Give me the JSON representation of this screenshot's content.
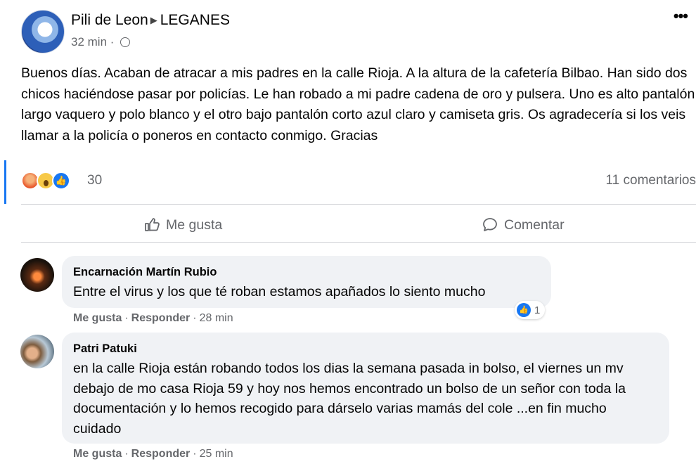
{
  "post": {
    "author": "Pili de Leon",
    "group": "LEGANES",
    "time": "32 min",
    "text": "Buenos días. Acaban de atracar a mis padres en la calle Rioja. A la altura de la cafetería Bilbao. Han sido dos chicos haciéndose pasar por policías. Le han robado a mi padre cadena de oro y pulsera. Uno es alto pantalón largo vaquero y polo blanco y el otro bajo pantalón corto azul claro y camiseta gris. Os agradecería si los veis llamar a la policía o poneros en contacto conmigo. Gracias",
    "reaction_count": "30",
    "comments_count": "11 comentarios",
    "more": "•••",
    "reaction_icons": [
      "angry-icon",
      "wow-icon",
      "like-icon"
    ]
  },
  "actions": {
    "like": "Me gusta",
    "comment": "Comentar"
  },
  "comments": [
    {
      "name": "Encarnación Martín Rubio",
      "text": "Entre el virus y los que té roban estamos apañados lo siento mucho",
      "like": "Me gusta",
      "reply": "Responder",
      "time": "28 min",
      "reaction_count": "1"
    },
    {
      "name": "Patri Patuki",
      "text": "en la calle Rioja están robando todos los dias la semana pasada in bolso, el viernes un mv debajo de mo casa Rioja 59 y hoy nos hemos encontrado un bolso de un señor con toda la documentación y lo hemos recogido para dárselo varias mamás del cole ...en fin mucho cuidado",
      "like": "Me gusta",
      "reply": "Responder",
      "time": "25 min"
    }
  ],
  "colors": {
    "accent": "#1877f2",
    "secondary_text": "#65676b",
    "bubble": "#f0f2f5"
  }
}
